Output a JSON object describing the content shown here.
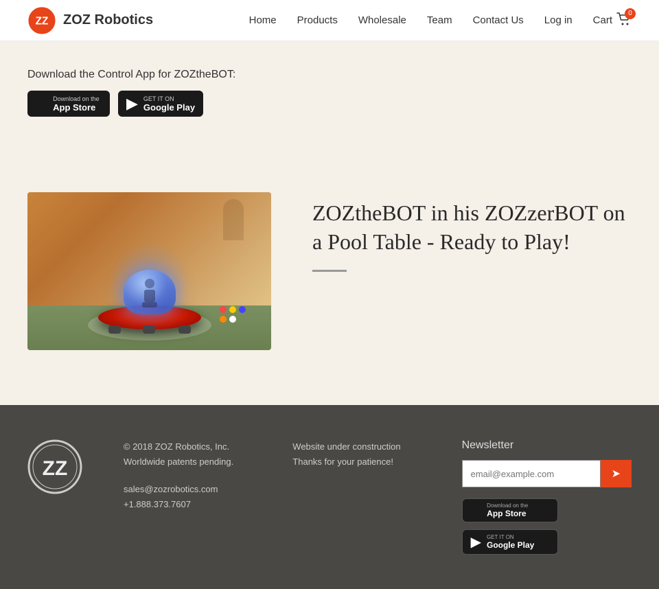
{
  "site": {
    "name": "ZOZ Robotics",
    "logo_letter": "ZZ"
  },
  "nav": {
    "links": [
      {
        "label": "Home",
        "href": "#"
      },
      {
        "label": "Products",
        "href": "#"
      },
      {
        "label": "Wholesale",
        "href": "#"
      },
      {
        "label": "Team",
        "href": "#"
      },
      {
        "label": "Contact Us",
        "href": "#"
      },
      {
        "label": "Log in",
        "href": "#"
      }
    ],
    "cart_label": "Cart",
    "cart_count": "0"
  },
  "hero": {
    "download_text": "Download the Control App for ZOZtheBOT:",
    "appstore_sub": "Download on the",
    "appstore_main": "App Store",
    "google_sub": "GET IT ON",
    "google_main": "Google Play"
  },
  "product": {
    "title": "ZOZtheBOT in his ZOZzerBOT on a Pool Table - Ready to Play!",
    "image_alt": "ZOZtheBOT robot on pool table"
  },
  "footer": {
    "copyright": "© 2018 ZOZ Robotics, Inc.",
    "patents": "Worldwide patents pending.",
    "email": "sales@zozrobotics.com",
    "phone": "+1.888.373.7607",
    "website_status": "Website under construction",
    "thanks": "Thanks for your patience!",
    "newsletter_title": "Newsletter",
    "newsletter_placeholder": "email@example.com",
    "appstore_sub": "Download on the",
    "appstore_main": "App Store",
    "google_sub": "GET IT ON",
    "google_main": "Google Play"
  }
}
